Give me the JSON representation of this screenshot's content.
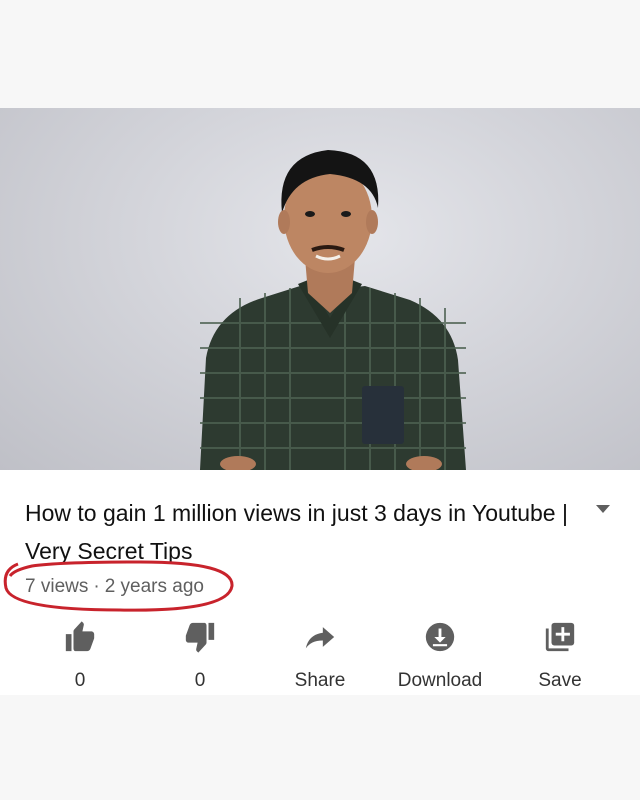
{
  "video": {
    "title": "How to gain 1 million views in just 3 days in Youtube | Very Secret Tips",
    "views": "7 views",
    "separator": "·",
    "age": "2 years ago"
  },
  "actions": {
    "like": {
      "label": "0",
      "icon": "thumbs-up-icon"
    },
    "dislike": {
      "label": "0",
      "icon": "thumbs-down-icon"
    },
    "share": {
      "label": "Share",
      "icon": "share-arrow-icon"
    },
    "download": {
      "label": "Download",
      "icon": "download-icon"
    },
    "save": {
      "label": "Save",
      "icon": "playlist-add-icon"
    }
  },
  "colors": {
    "annotation": "#c8232c",
    "icon": "#5f5f5f",
    "meta_text": "#5f5f5f",
    "title_text": "#111111"
  }
}
